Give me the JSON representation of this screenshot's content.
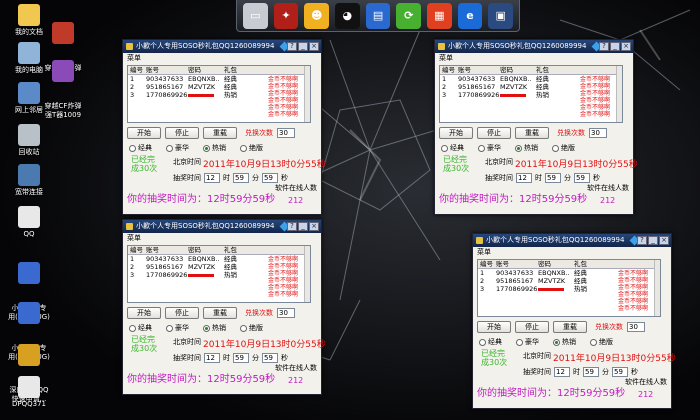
{
  "desktop": {
    "icons": [
      {
        "label": "我的文档",
        "icon": "documents-icon"
      },
      {
        "label": "穿越CF炸弹\n强T器",
        "icon": "cf-tool-icon"
      },
      {
        "label": "我的电脑",
        "icon": "computer-icon"
      },
      {
        "label": "穿越CF炸弹\n强T器1009",
        "icon": "cf-tool-icon"
      },
      {
        "label": "网上邻居",
        "icon": "network-icon"
      },
      {
        "label": "回收站",
        "icon": "recycle-bin-icon"
      },
      {
        "label": "宽带连接",
        "icon": "broadband-icon"
      },
      {
        "label": "QQ",
        "icon": "qq-file-icon"
      },
      {
        "label": "小歉个人专\n用(修复BUG)",
        "icon": "app-icon"
      },
      {
        "label": "小歉个人专\n用(修复BUG)",
        "icon": "app-icon"
      },
      {
        "label": "深度全能QQ\n快速申请...",
        "icon": "qq-apply-icon"
      },
      {
        "label": "DPQQ371",
        "icon": "qq-file-icon"
      }
    ]
  },
  "toolbar": {
    "buttons": [
      "drive-icon",
      "crossfire-icon",
      "qq-pet-icon",
      "qq-penguin-icon",
      "film-icon",
      "speed-icon",
      "office-icon",
      "ie-browser-icon",
      "monitor-icon"
    ]
  },
  "window": {
    "title": "小歉个人专用SOSO秒礼包QQ1260089994",
    "menu": "菜单",
    "columns": [
      "编号",
      "账号",
      "密码",
      "礼包"
    ],
    "rows": [
      {
        "no": "1",
        "account": "903437633",
        "password": "EBQNXB..",
        "gift": "经典"
      },
      {
        "no": "2",
        "account": "951865167",
        "password": "MZVTZK",
        "gift": "经典"
      },
      {
        "no": "3",
        "account": "1770869926",
        "password": "",
        "gift": "热销"
      }
    ],
    "buttons": {
      "start": "开始",
      "stop": "停止",
      "reload": "重载"
    },
    "count_label": "兑换次数",
    "count_value": "30",
    "radios": [
      "经典",
      "豪华",
      "热销",
      "绝版"
    ],
    "done_text": "已经完成30次",
    "beijing_label": "北京时间",
    "beijing_time": "2011年10月9日13时0分55秒",
    "draw_label": "抽奖时间",
    "draw_hour": "12",
    "hour_unit": "时",
    "draw_min": "59",
    "min_unit": "分",
    "draw_sec": "59",
    "sec_unit": "秒",
    "result_text": "你的抽奖时间为：12时59分59秒",
    "online_label": "软件在线人数",
    "online_value": "212",
    "log_line": "金币不够啊"
  },
  "colors": {
    "accent_red": "#e01010",
    "accent_green": "#3bb82e",
    "accent_magenta": "#c21cc2",
    "title_blue": "#14264a"
  }
}
